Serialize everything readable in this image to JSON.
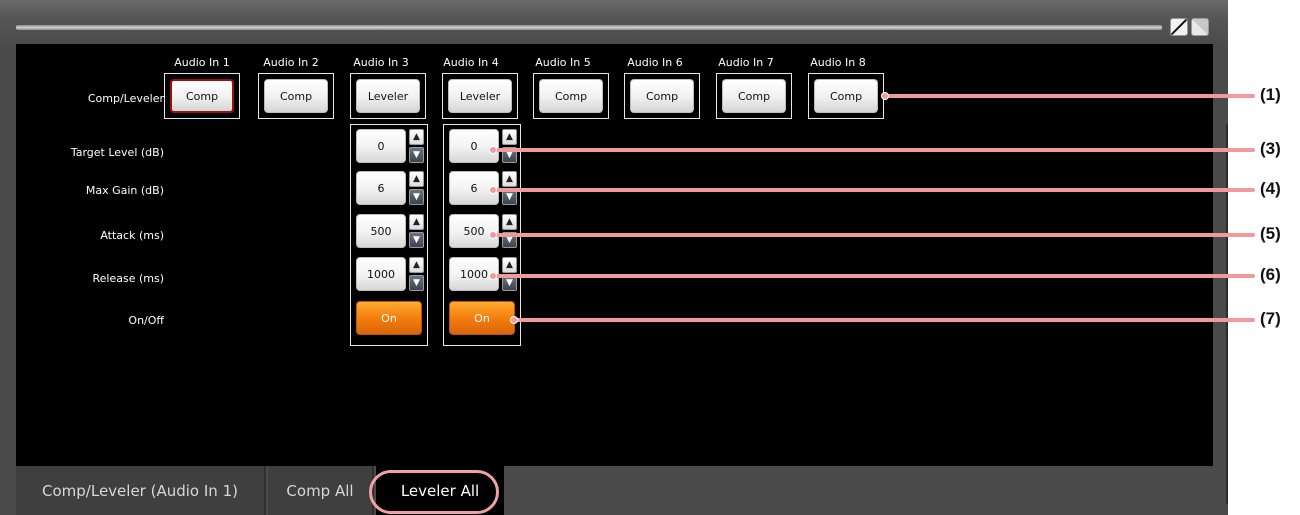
{
  "window": {
    "pen_icon": "pencil-icon",
    "fill_icon": "fill-icon"
  },
  "row_labels": {
    "mode": "Comp/Leveler",
    "target": "Target Level (dB)",
    "max_gain": "Max Gain (dB)",
    "attack": "Attack (ms)",
    "release": "Release (ms)",
    "onoff": "On/Off"
  },
  "channels": [
    {
      "title": "Audio In 1",
      "mode": "Comp"
    },
    {
      "title": "Audio In 2",
      "mode": "Comp"
    },
    {
      "title": "Audio In 3",
      "mode": "Leveler"
    },
    {
      "title": "Audio In 4",
      "mode": "Leveler"
    },
    {
      "title": "Audio In 5",
      "mode": "Comp"
    },
    {
      "title": "Audio In 6",
      "mode": "Comp"
    },
    {
      "title": "Audio In 7",
      "mode": "Comp"
    },
    {
      "title": "Audio In 8",
      "mode": "Comp"
    }
  ],
  "leveler_groups": [
    {
      "target": "0",
      "max_gain": "6",
      "attack": "500",
      "release": "1000",
      "onoff": "On"
    },
    {
      "target": "0",
      "max_gain": "6",
      "attack": "500",
      "release": "1000",
      "onoff": "On"
    }
  ],
  "spin": {
    "up": "▲",
    "down": "▼"
  },
  "tabs": [
    "Comp/Leveler (Audio In 1)",
    "Comp All",
    "Leveler All"
  ],
  "callouts": [
    "(1)",
    "(3)",
    "(4)",
    "(5)",
    "(6)",
    "(7)"
  ],
  "colors": {
    "active_border": "#9a1010",
    "on_button": "#f37a0c",
    "callout_line": "#f09a9e"
  }
}
